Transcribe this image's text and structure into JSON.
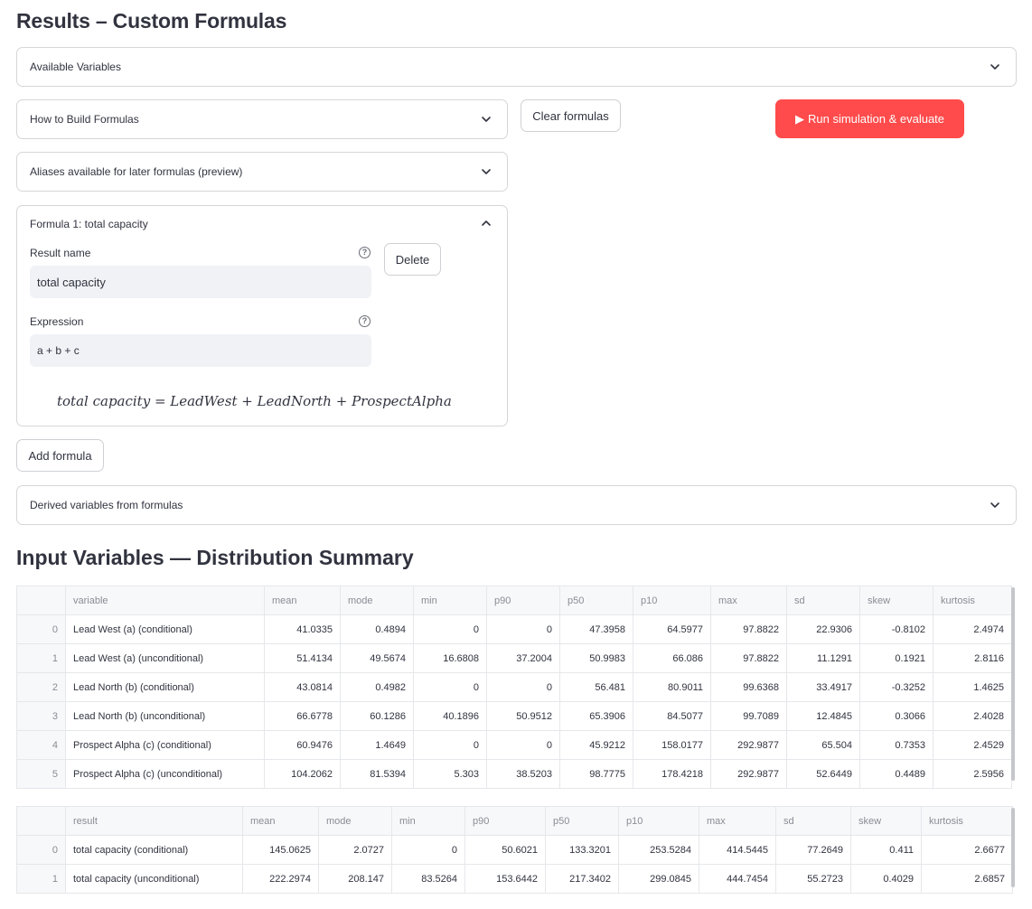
{
  "page": {
    "title": "Results – Custom Formulas",
    "section2_title": "Input Variables — Distribution Summary"
  },
  "expanders": {
    "available_variables": "Available Variables",
    "how_to_build": "How to Build Formulas",
    "aliases": "Aliases available for later formulas (preview)",
    "formula1": "Formula 1: total capacity",
    "derived": "Derived variables from formulas"
  },
  "buttons": {
    "clear": "Clear formulas",
    "run": "Run simulation & evaluate",
    "run_icon": "▶",
    "delete": "Delete",
    "add": "Add formula"
  },
  "formula1": {
    "result_name_label": "Result name",
    "result_name_value": "total capacity",
    "expression_label": "Expression",
    "expression_value": "a + b + c",
    "rendered": "total capacity = LeadWest + LeadNorth + ProspectAlpha"
  },
  "colors": {
    "accent": "#ff4b4b",
    "input_bg": "#f0f2f6",
    "border": "#d6d6d9"
  },
  "input_table": {
    "headers": [
      "",
      "variable",
      "mean",
      "mode",
      "min",
      "p90",
      "p50",
      "p10",
      "max",
      "sd",
      "skew",
      "kurtosis"
    ],
    "rows": [
      [
        "0",
        "Lead West (a) (conditional)",
        "41.0335",
        "0.4894",
        "0",
        "0",
        "47.3958",
        "64.5977",
        "97.8822",
        "22.9306",
        "-0.8102",
        "2.4974"
      ],
      [
        "1",
        "Lead West (a) (unconditional)",
        "51.4134",
        "49.5674",
        "16.6808",
        "37.2004",
        "50.9983",
        "66.086",
        "97.8822",
        "11.1291",
        "0.1921",
        "2.8116"
      ],
      [
        "2",
        "Lead North (b) (conditional)",
        "43.0814",
        "0.4982",
        "0",
        "0",
        "56.481",
        "80.9011",
        "99.6368",
        "33.4917",
        "-0.3252",
        "1.4625"
      ],
      [
        "3",
        "Lead North (b) (unconditional)",
        "66.6778",
        "60.1286",
        "40.1896",
        "50.9512",
        "65.3906",
        "84.5077",
        "99.7089",
        "12.4845",
        "0.3066",
        "2.4028"
      ],
      [
        "4",
        "Prospect Alpha (c) (conditional)",
        "60.9476",
        "1.4649",
        "0",
        "0",
        "45.9212",
        "158.0177",
        "292.9877",
        "65.504",
        "0.7353",
        "2.4529"
      ],
      [
        "5",
        "Prospect Alpha (c) (unconditional)",
        "104.2062",
        "81.5394",
        "5.303",
        "38.5203",
        "98.7775",
        "178.4218",
        "292.9877",
        "52.6449",
        "0.4489",
        "2.5956"
      ]
    ]
  },
  "result_table": {
    "headers": [
      "",
      "result",
      "mean",
      "mode",
      "min",
      "p90",
      "p50",
      "p10",
      "max",
      "sd",
      "skew",
      "kurtosis"
    ],
    "rows": [
      [
        "0",
        "total capacity (conditional)",
        "145.0625",
        "2.0727",
        "0",
        "50.6021",
        "133.3201",
        "253.5284",
        "414.5445",
        "77.2649",
        "0.411",
        "2.6677"
      ],
      [
        "1",
        "total capacity (unconditional)",
        "222.2974",
        "208.147",
        "83.5264",
        "153.6442",
        "217.3402",
        "299.0845",
        "444.7454",
        "55.2723",
        "0.4029",
        "2.6857"
      ]
    ]
  }
}
